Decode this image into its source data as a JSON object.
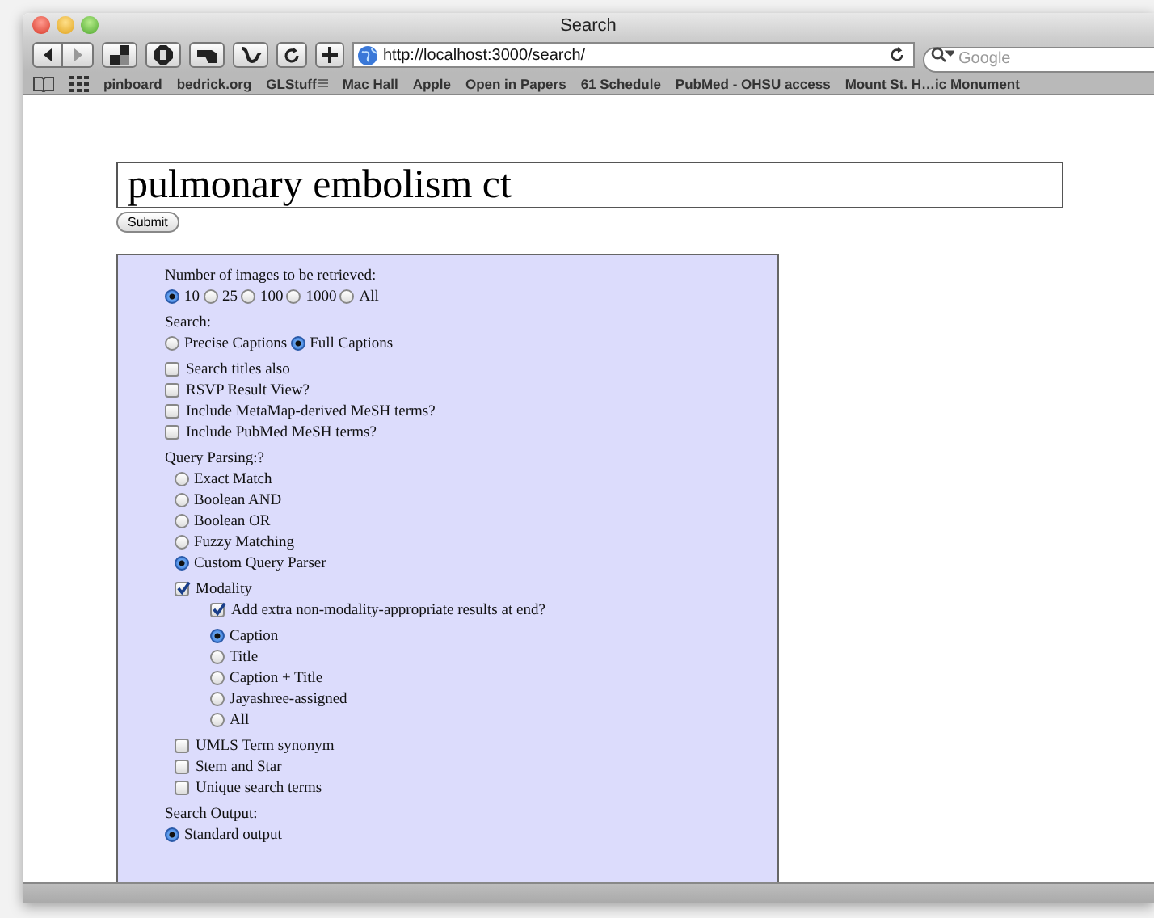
{
  "window": {
    "title": "Search"
  },
  "toolbar": {
    "url": "http://localhost:3000/search/",
    "search": {
      "placeholder": "Google"
    }
  },
  "bookmarks": [
    {
      "label": "pinboard",
      "kind": "link"
    },
    {
      "label": "bedrick.org",
      "kind": "link"
    },
    {
      "label": "GLStuff",
      "kind": "folder"
    },
    {
      "label": "Mac Hall",
      "kind": "link"
    },
    {
      "label": "Apple",
      "kind": "link"
    },
    {
      "label": "Open in Papers",
      "kind": "link"
    },
    {
      "label": "61 Schedule",
      "kind": "link"
    },
    {
      "label": "PubMed - OHSU access",
      "kind": "link"
    },
    {
      "label": "Mount St. H…ic Monument",
      "kind": "link"
    }
  ],
  "query": {
    "value": "pulmonary embolism ct",
    "submit": "Submit"
  },
  "form": [
    {
      "kind": "heading",
      "text": "Number of images to be retrieved:"
    },
    {
      "kind": "radio-row",
      "options": [
        {
          "label": "10",
          "selected": true
        },
        {
          "label": "25",
          "selected": false
        },
        {
          "label": "100",
          "selected": false
        },
        {
          "label": "1000",
          "selected": false
        },
        {
          "label": "All",
          "selected": false
        }
      ]
    },
    {
      "kind": "heading",
      "text": "Search:"
    },
    {
      "kind": "radio-row",
      "options": [
        {
          "label": "Precise Captions",
          "selected": false
        },
        {
          "label": "Full Captions",
          "selected": true
        }
      ]
    },
    {
      "kind": "checkbox",
      "label": "Search titles also",
      "checked": false
    },
    {
      "kind": "checkbox",
      "label": "RSVP Result View?",
      "checked": false
    },
    {
      "kind": "checkbox",
      "label": "Include MetaMap-derived MeSH terms?",
      "checked": false
    },
    {
      "kind": "checkbox",
      "label": "Include PubMed MeSH terms?",
      "checked": false
    },
    {
      "kind": "heading",
      "text": "Query Parsing:?",
      "children": [
        {
          "kind": "radio",
          "label": "Exact Match",
          "selected": false
        },
        {
          "kind": "radio",
          "label": "Boolean AND",
          "selected": false
        },
        {
          "kind": "radio",
          "label": "Boolean OR",
          "selected": false
        },
        {
          "kind": "radio",
          "label": "Fuzzy Matching",
          "selected": false
        },
        {
          "kind": "radio",
          "label": "Custom Query Parser",
          "selected": true
        },
        {
          "kind": "checkbox",
          "label": "Modality",
          "checked": true,
          "children": [
            {
              "kind": "checkbox",
              "label": "Add extra non-modality-appropriate results at end?",
              "checked": true
            },
            {
              "kind": "radio",
              "label": "Caption",
              "selected": true
            },
            {
              "kind": "radio",
              "label": "Title",
              "selected": false
            },
            {
              "kind": "radio",
              "label": "Caption + Title",
              "selected": false
            },
            {
              "kind": "radio",
              "label": "Jayashree-assigned",
              "selected": false
            },
            {
              "kind": "radio",
              "label": "All",
              "selected": false
            }
          ]
        },
        {
          "kind": "checkbox",
          "label": "UMLS Term synonym",
          "checked": false
        },
        {
          "kind": "checkbox",
          "label": "Stem and Star",
          "checked": false
        },
        {
          "kind": "checkbox",
          "label": "Unique search terms",
          "checked": false
        }
      ]
    },
    {
      "kind": "heading",
      "text": "Search Output:"
    },
    {
      "kind": "radio",
      "label": "Standard output",
      "selected": true
    }
  ]
}
